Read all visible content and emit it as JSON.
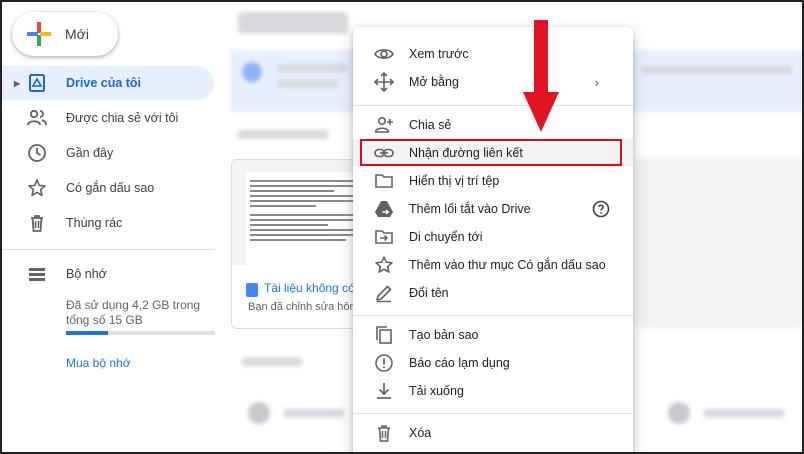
{
  "sidebar": {
    "new_button": "Mới",
    "items": [
      {
        "label": "Drive của tôi",
        "icon": "drive-icon",
        "active": true
      },
      {
        "label": "Được chia sẻ với tôi",
        "icon": "shared-people-icon"
      },
      {
        "label": "Gần đây",
        "icon": "clock-icon"
      },
      {
        "label": "Có gắn dấu sao",
        "icon": "star-icon"
      },
      {
        "label": "Thùng rác",
        "icon": "trash-icon"
      }
    ],
    "storage": {
      "label": "Bộ nhớ",
      "icon": "storage-icon",
      "usage_text": "Đã sử dụng 4,2 GB trong tổng số 15 GB",
      "used_fraction": 0.28,
      "buy_link": "Mua bộ nhớ"
    }
  },
  "background": {
    "card": {
      "title": "Tài liệu không có",
      "subtitle": "Bạn đã chỉnh sửa hôm"
    }
  },
  "context_menu": {
    "groups": [
      [
        {
          "label": "Xem trước",
          "icon": "eye-icon"
        },
        {
          "label": "Mở bằng",
          "icon": "move-arrows-icon",
          "has_submenu": true
        }
      ],
      [
        {
          "label": "Chia sẻ",
          "icon": "add-person-icon"
        },
        {
          "label": "Nhận đường liên kết",
          "icon": "link-icon",
          "highlighted": true
        },
        {
          "label": "Hiển thị vị trí tệp",
          "icon": "folder-icon"
        },
        {
          "label": "Thêm lối tắt vào Drive",
          "icon": "drive-shortcut-icon",
          "help_icon": true
        },
        {
          "label": "Di chuyển tới",
          "icon": "move-to-folder-icon"
        },
        {
          "label": "Thêm vào thư mục Có gắn dấu sao",
          "icon": "star-icon"
        },
        {
          "label": "Đổi tên",
          "icon": "pencil-icon"
        }
      ],
      [
        {
          "label": "Tạo bản sao",
          "icon": "copy-icon"
        },
        {
          "label": "Báo cáo lạm dụng",
          "icon": "report-icon"
        },
        {
          "label": "Tải xuống",
          "icon": "download-icon"
        }
      ],
      [
        {
          "label": "Xóa",
          "icon": "trash-icon"
        }
      ]
    ]
  },
  "annotation": {
    "arrow_color": "#e11422",
    "box_color": "#d90e1b"
  },
  "colors": {
    "accent": "#1a73e8",
    "active_bg": "#e8f0fe"
  }
}
